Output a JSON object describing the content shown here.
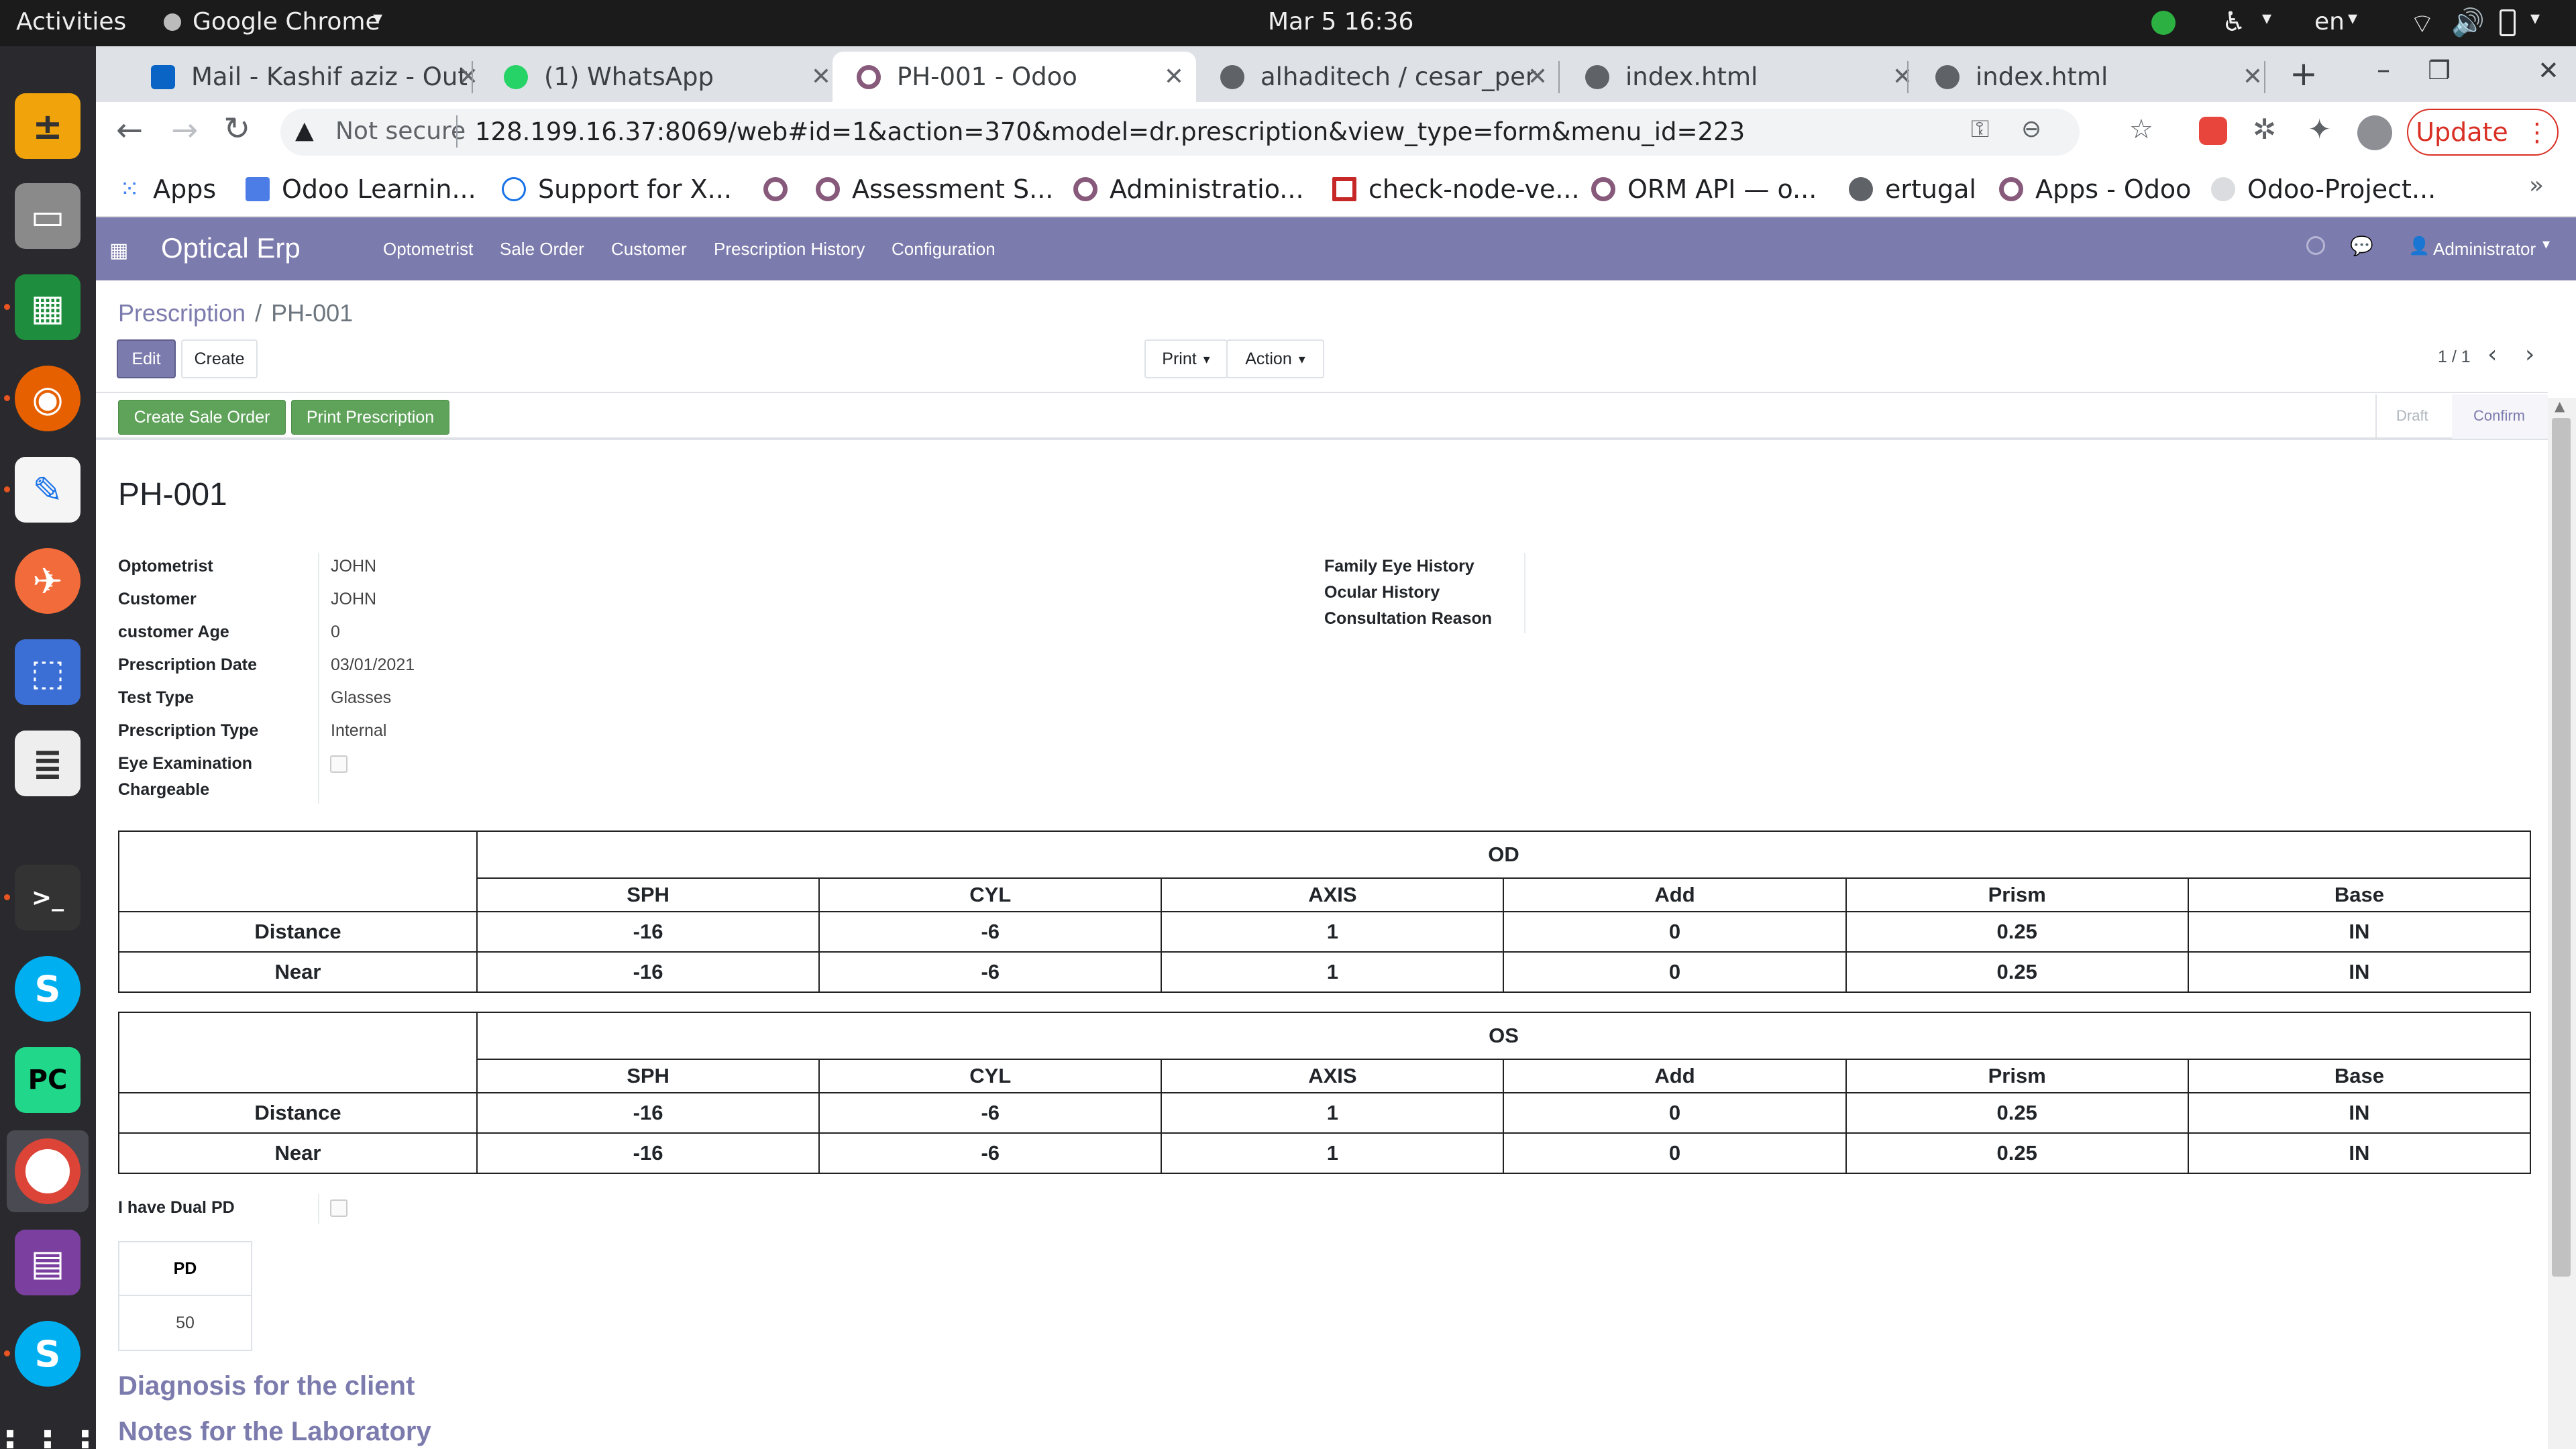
{
  "os": {
    "activities": "Activities",
    "app_name": "Google Chrome",
    "datetime": "Mar 5  16:36",
    "lang": "en"
  },
  "chrome": {
    "tabs": [
      {
        "label": "Mail - Kashif aziz - Out"
      },
      {
        "label": "(1) WhatsApp"
      },
      {
        "label": "PH-001 - Odoo"
      },
      {
        "label": "alhaditech / cesar_per"
      },
      {
        "label": "index.html"
      },
      {
        "label": "index.html"
      }
    ],
    "security": "Not secure",
    "url": "128.199.16.37:8069/web#id=1&action=370&model=dr.prescription&view_type=form&menu_id=223",
    "update_label": "Update",
    "bookmarks": [
      {
        "label": "Apps"
      },
      {
        "label": "Odoo Learnin..."
      },
      {
        "label": "Support for X..."
      },
      {
        "label": ""
      },
      {
        "label": "Assessment S..."
      },
      {
        "label": "Administratio..."
      },
      {
        "label": "check-node-ve..."
      },
      {
        "label": "ORM API — o..."
      },
      {
        "label": "ertugal"
      },
      {
        "label": "Apps - Odoo"
      },
      {
        "label": "Odoo-Project..."
      }
    ]
  },
  "odoo": {
    "brand": "Optical Erp",
    "menu": [
      "Optometrist",
      "Sale Order",
      "Customer",
      "Prescription History",
      "Configuration"
    ],
    "user": "Administrator",
    "breadcrumb": {
      "parent": "Prescription",
      "sep": "/",
      "current": "PH-001"
    },
    "buttons": {
      "edit": "Edit",
      "create": "Create",
      "print": "Print",
      "action": "Action",
      "create_so": "Create Sale Order",
      "print_rx": "Print Prescription"
    },
    "pager": "1 / 1",
    "status": {
      "draft": "Draft",
      "confirm": "Confirm"
    },
    "record": {
      "title": "PH-001",
      "fields": [
        {
          "label": "Optometrist",
          "value": "JOHN"
        },
        {
          "label": "Customer",
          "value": "JOHN"
        },
        {
          "label": "customer Age",
          "value": "0"
        },
        {
          "label": "Prescription Date",
          "value": "03/01/2021"
        },
        {
          "label": "Test Type",
          "value": "Glasses"
        },
        {
          "label": "Prescription Type",
          "value": "Internal"
        },
        {
          "label": "Eye Examination",
          "value": ""
        }
      ],
      "chargeable_label": "Chargeable",
      "right_fields": [
        "Family Eye History",
        "Ocular History",
        "Consultation Reason"
      ],
      "od": {
        "title": "OD",
        "headers": [
          "SPH",
          "CYL",
          "AXIS",
          "Add",
          "Prism",
          "Base"
        ],
        "rows": [
          {
            "label": "Distance",
            "values": [
              "-16",
              "-6",
              "1",
              "0",
              "0.25",
              "IN"
            ]
          },
          {
            "label": "Near",
            "values": [
              "-16",
              "-6",
              "1",
              "0",
              "0.25",
              "IN"
            ]
          }
        ]
      },
      "os": {
        "title": "OS",
        "headers": [
          "SPH",
          "CYL",
          "AXIS",
          "Add",
          "Prism",
          "Base"
        ],
        "rows": [
          {
            "label": "Distance",
            "values": [
              "-16",
              "-6",
              "1",
              "0",
              "0.25",
              "IN"
            ]
          },
          {
            "label": "Near",
            "values": [
              "-16",
              "-6",
              "1",
              "0",
              "0.25",
              "IN"
            ]
          }
        ]
      },
      "dual_pd_label": "I have Dual PD",
      "pd_header": "PD",
      "pd_value": "50",
      "diagnosis_title": "Diagnosis for the client",
      "notes_title": "Notes for the Laboratory"
    }
  }
}
